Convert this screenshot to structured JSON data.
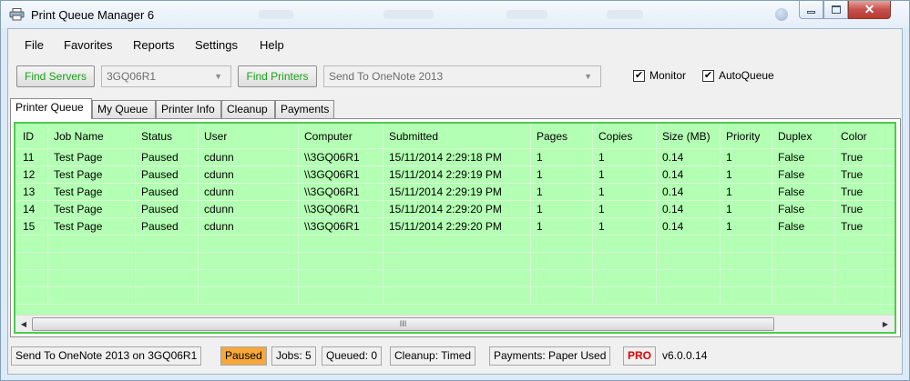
{
  "window": {
    "title": "Print Queue Manager 6",
    "close_glyph": "✕"
  },
  "menu": [
    "File",
    "Favorites",
    "Reports",
    "Settings",
    "Help"
  ],
  "toolbar": {
    "find_servers_label": "Find Servers",
    "server_value": "3GQ06R1",
    "find_printers_label": "Find Printers",
    "printer_value": "Send To OneNote 2013",
    "monitor_label": "Monitor",
    "monitor_checked": true,
    "autoqueue_label": "AutoQueue",
    "autoqueue_checked": true,
    "check_glyph": "✔",
    "dropdown_glyph": "▼"
  },
  "tabs": [
    "Printer Queue",
    "My Queue",
    "Printer Info",
    "Cleanup",
    "Payments"
  ],
  "grid": {
    "columns": [
      "ID",
      "Job Name",
      "Status",
      "User",
      "Computer",
      "Submitted",
      "Pages",
      "Copies",
      "Size (MB)",
      "Priority",
      "Duplex",
      "Color"
    ],
    "rows": [
      [
        "11",
        "Test Page",
        "Paused",
        "cdunn",
        "\\\\3GQ06R1",
        "15/11/2014 2:29:18 PM",
        "1",
        "1",
        "0.14",
        "1",
        "False",
        "True"
      ],
      [
        "12",
        "Test Page",
        "Paused",
        "cdunn",
        "\\\\3GQ06R1",
        "15/11/2014 2:29:19 PM",
        "1",
        "1",
        "0.14",
        "1",
        "False",
        "True"
      ],
      [
        "13",
        "Test Page",
        "Paused",
        "cdunn",
        "\\\\3GQ06R1",
        "15/11/2014 2:29:19 PM",
        "1",
        "1",
        "0.14",
        "1",
        "False",
        "True"
      ],
      [
        "14",
        "Test Page",
        "Paused",
        "cdunn",
        "\\\\3GQ06R1",
        "15/11/2014 2:29:20 PM",
        "1",
        "1",
        "0.14",
        "1",
        "False",
        "True"
      ],
      [
        "15",
        "Test Page",
        "Paused",
        "cdunn",
        "\\\\3GQ06R1",
        "15/11/2014 2:29:20 PM",
        "1",
        "1",
        "0.14",
        "1",
        "False",
        "True"
      ]
    ],
    "scroll_left_glyph": "◀",
    "scroll_right_glyph": "▶",
    "scroll_thumb_grip": "III"
  },
  "status": {
    "printer": "Send To OneNote 2013 on 3GQ06R1",
    "state": "Paused",
    "jobs": "Jobs: 5",
    "queued": "Queued: 0",
    "cleanup": "Cleanup: Timed",
    "payments": "Payments: Paper Used",
    "pro": "PRO",
    "version": "v6.0.0.14"
  },
  "colors": {
    "grid_background": "#b3ffb3",
    "grid_border": "#4ecb4e",
    "button_text": "#1aa31a",
    "paused_badge": "#f7a83a",
    "pro_text": "#e00000"
  },
  "icons": [
    "printer-icon",
    "minimize-icon",
    "maximize-icon",
    "close-icon",
    "dropdown-arrow-icon",
    "checkmark-icon",
    "scroll-left-icon",
    "scroll-right-icon"
  ]
}
